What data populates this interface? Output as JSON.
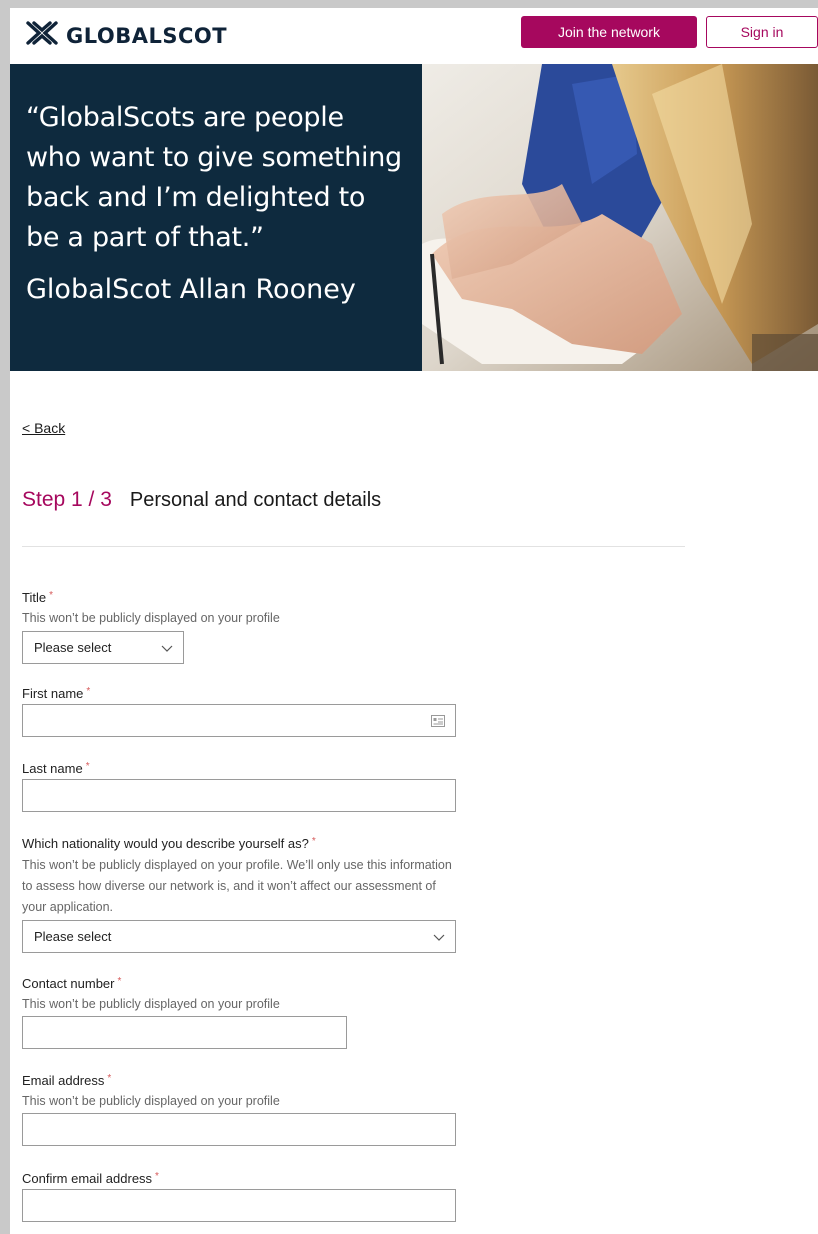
{
  "header": {
    "logo_text": "GLOBALSCOT",
    "join_label": "Join the network",
    "signin_label": "Sign in",
    "accent_color": "#a6085e",
    "brand_dark": "#0e2a3e"
  },
  "hero": {
    "quote": "“GlobalScots are people who want to give something back and I’m delighted to be a part of that.”",
    "author": "GlobalScot Allan Rooney"
  },
  "nav": {
    "back_label": "< Back"
  },
  "step": {
    "number": "Step 1 / 3",
    "title": "Personal and contact details"
  },
  "form": {
    "title": {
      "label": "Title",
      "hint": "This won’t be publicly displayed on your profile",
      "value": "Please select"
    },
    "first_name": {
      "label": "First name",
      "value": ""
    },
    "last_name": {
      "label": "Last name",
      "value": ""
    },
    "nationality": {
      "label": "Which nationality would you describe yourself as?",
      "hint": "This won’t be publicly displayed on your profile. We’ll only use this information to assess how diverse our network is, and it won’t affect our assessment of your application.",
      "value": "Please select"
    },
    "contact_number": {
      "label": "Contact number",
      "hint": "This won’t be publicly displayed on your profile",
      "value": ""
    },
    "email": {
      "label": "Email address",
      "hint": "This won’t be publicly displayed on your profile",
      "value": ""
    },
    "confirm_email": {
      "label": "Confirm email address",
      "value": ""
    },
    "required_marker": "*"
  }
}
